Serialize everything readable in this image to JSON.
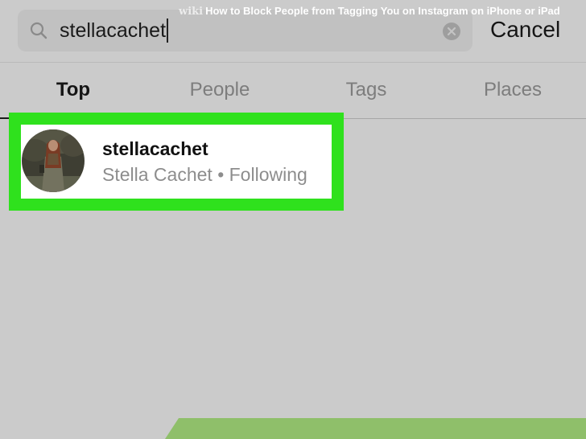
{
  "search": {
    "query": "stellacachet",
    "icon": "search-icon",
    "clear_icon": "clear-circle-icon"
  },
  "cancel_label": "Cancel",
  "tabs": [
    {
      "label": "Top",
      "active": true
    },
    {
      "label": "People",
      "active": false
    },
    {
      "label": "Tags",
      "active": false
    },
    {
      "label": "Places",
      "active": false
    }
  ],
  "result": {
    "username": "stellacachet",
    "subtitle": "Stella Cachet • Following"
  },
  "banner": {
    "wiki": "wiki",
    "how": "How",
    "rest": " to Block People from Tagging You on Instagram on iPhone or iPad"
  },
  "colors": {
    "background": "#cbcbcb",
    "search_field": "#c1c1c1",
    "highlight": "#2fe11d",
    "banner": "#8fbf6a"
  }
}
